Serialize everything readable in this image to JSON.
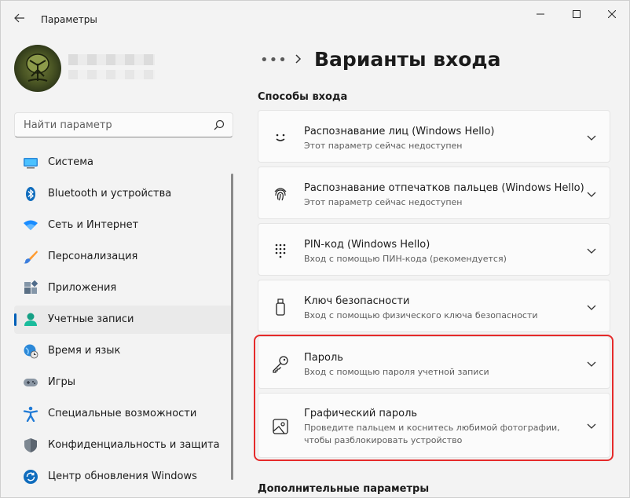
{
  "window": {
    "title": "Параметры",
    "back_icon": "back-arrow-icon",
    "controls": [
      "minimize-icon",
      "maximize-icon",
      "close-icon"
    ]
  },
  "profile": {
    "name": "",
    "email": ""
  },
  "search": {
    "placeholder": "Найти параметр",
    "icon": "search-icon"
  },
  "nav": {
    "items": [
      {
        "label": "Система",
        "icon": "system-icon",
        "active": false
      },
      {
        "label": "Bluetooth и устройства",
        "icon": "bluetooth-icon",
        "active": false
      },
      {
        "label": "Сеть и Интернет",
        "icon": "wifi-icon",
        "active": false
      },
      {
        "label": "Персонализация",
        "icon": "brush-icon",
        "active": false
      },
      {
        "label": "Приложения",
        "icon": "apps-icon",
        "active": false
      },
      {
        "label": "Учетные записи",
        "icon": "account-icon",
        "active": true
      },
      {
        "label": "Время и язык",
        "icon": "globe-clock-icon",
        "active": false
      },
      {
        "label": "Игры",
        "icon": "gamepad-icon",
        "active": false
      },
      {
        "label": "Специальные возможности",
        "icon": "accessibility-icon",
        "active": false
      },
      {
        "label": "Конфиденциальность и защита",
        "icon": "shield-icon",
        "active": false
      },
      {
        "label": "Центр обновления Windows",
        "icon": "update-icon",
        "active": false
      }
    ]
  },
  "header": {
    "breadcrumb_more": "•••",
    "title": "Варианты входа"
  },
  "sections": {
    "signin_title": "Способы входа",
    "additional_title": "Дополнительные параметры"
  },
  "options": [
    {
      "title": "Распознавание лиц (Windows Hello)",
      "subtitle": "Этот параметр сейчас недоступен",
      "icon": "face-icon"
    },
    {
      "title": "Распознавание отпечатков пальцев (Windows Hello)",
      "subtitle": "Этот параметр сейчас недоступен",
      "icon": "fingerprint-icon"
    },
    {
      "title": "PIN-код (Windows Hello)",
      "subtitle": "Вход с помощью ПИН-кода (рекомендуется)",
      "icon": "pin-keypad-icon"
    },
    {
      "title": "Ключ безопасности",
      "subtitle": "Вход с помощью физического ключа безопасности",
      "icon": "usb-key-icon"
    },
    {
      "title": "Пароль",
      "subtitle": "Вход с помощью пароля учетной записи",
      "icon": "key-icon"
    },
    {
      "title": "Графический пароль",
      "subtitle": "Проведите пальцем и коснитесь любимой фотографии, чтобы разблокировать устройство",
      "icon": "picture-icon"
    }
  ],
  "colors": {
    "accent": "#005fb8",
    "highlight": "#e52a2a",
    "background": "#f3f3f3",
    "card": "#fbfbfb"
  }
}
